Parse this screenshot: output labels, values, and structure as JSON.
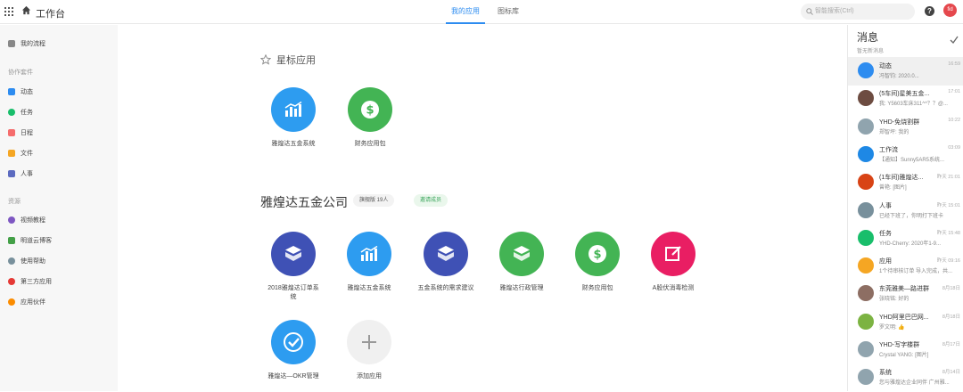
{
  "header": {
    "title": "工作台",
    "tabs": [
      {
        "label": "我的应用"
      },
      {
        "label": "图标库"
      }
    ],
    "search_placeholder": "智能搜索(Ctrl)",
    "avatar_text": "fid"
  },
  "sidebar": {
    "top_item": "我的流程",
    "section1": "协作套件",
    "suite": [
      {
        "label": "动态",
        "color": "#2d8cf0"
      },
      {
        "label": "任务",
        "color": "#19be6b"
      },
      {
        "label": "日程",
        "color": "#f56c6c"
      },
      {
        "label": "文件",
        "color": "#f5a623"
      },
      {
        "label": "人事",
        "color": "#5c6bc0"
      }
    ],
    "section2": "资源",
    "resources": [
      {
        "label": "视频教程",
        "color": "#7e57c2"
      },
      {
        "label": "明道云博客",
        "color": "#43a047"
      },
      {
        "label": "使用帮助",
        "color": "#78909c"
      },
      {
        "label": "第三方应用",
        "color": "#e53935"
      },
      {
        "label": "应用伙伴",
        "color": "#fb8c00"
      }
    ]
  },
  "starred": {
    "title": "星标应用",
    "apps": [
      {
        "label": "雅煌达五金系统",
        "color": "#2d9cf0",
        "icon": "chart-icon"
      },
      {
        "label": "财务应用包",
        "color": "#43b454",
        "icon": "dollar-icon"
      }
    ]
  },
  "company": {
    "name": "雅煌达五金公司",
    "version_badge": "旗舰版 19人",
    "invite_badge": "邀请成员",
    "apps": [
      {
        "label": "2018雅煌达订单系统",
        "color": "#3f51b5",
        "icon": "cube-icon"
      },
      {
        "label": "雅煌达五金系统",
        "color": "#2d9cf0",
        "icon": "chart-icon"
      },
      {
        "label": "五金系统的需求建议",
        "color": "#3f51b5",
        "icon": "cube-icon"
      },
      {
        "label": "雅煌达行政管理",
        "color": "#43b454",
        "icon": "cube-icon"
      },
      {
        "label": "财务应用包",
        "color": "#43b454",
        "icon": "dollar-icon"
      },
      {
        "label": "A股伏消毒检测",
        "color": "#e91e63",
        "icon": "edit-icon"
      },
      {
        "label": "雅煌达—OKR管理",
        "color": "#2d9cf0",
        "icon": "check-icon"
      },
      {
        "label": "添加应用",
        "color": "#f0f0f0",
        "icon": "plus-icon"
      }
    ]
  },
  "messages": {
    "title": "消息",
    "subtitle": "暂无新消息",
    "items": [
      {
        "name": "动态",
        "time": "16:59",
        "text": "冯智钧: 2020.0...",
        "color": "#2d8cf0"
      },
      {
        "name": "(5车间)星美五金...",
        "time": "17:01",
        "text": "我: Y5603车床311^^？？@...",
        "color": "#6d4c41"
      },
      {
        "name": "YHD-免烧割群",
        "time": "10:22",
        "text": "郑智坪: 我的",
        "color": "#90a4ae"
      },
      {
        "name": "工作流",
        "time": "03:09",
        "text": "【通知】Sunny5AR5系统...",
        "color": "#1e88e5"
      },
      {
        "name": "(1车间)雅煌达...",
        "time": "昨天 21:01",
        "text": "曾艳: [图片]",
        "color": "#d84315"
      },
      {
        "name": "人事",
        "time": "昨天 15:01",
        "text": "已经下班了，你明打下班卡",
        "color": "#78909c"
      },
      {
        "name": "任务",
        "time": "昨天 15:48",
        "text": "YHD-Cherry: 2020年1-9...",
        "color": "#19be6b"
      },
      {
        "name": "应用",
        "time": "昨天 09:16",
        "text": "1个待审核订单 导入完成，共...",
        "color": "#f5a623"
      },
      {
        "name": "东莞雅美—路进群",
        "time": "8月18日",
        "text": "张晓铭: 好的",
        "color": "#8d6e63"
      },
      {
        "name": "YHD阿里巴巴网...",
        "time": "8月18日",
        "text": "罗文明: 👍",
        "color": "#7cb342"
      },
      {
        "name": "YHD-写字楼群",
        "time": "8月17日",
        "text": "Crystal YANG: [图片]",
        "color": "#90a4ae"
      },
      {
        "name": "系统",
        "time": "8月14日",
        "text": "您与雅煌达企业同伴 广州雅...",
        "color": "#90a4ae"
      }
    ]
  }
}
